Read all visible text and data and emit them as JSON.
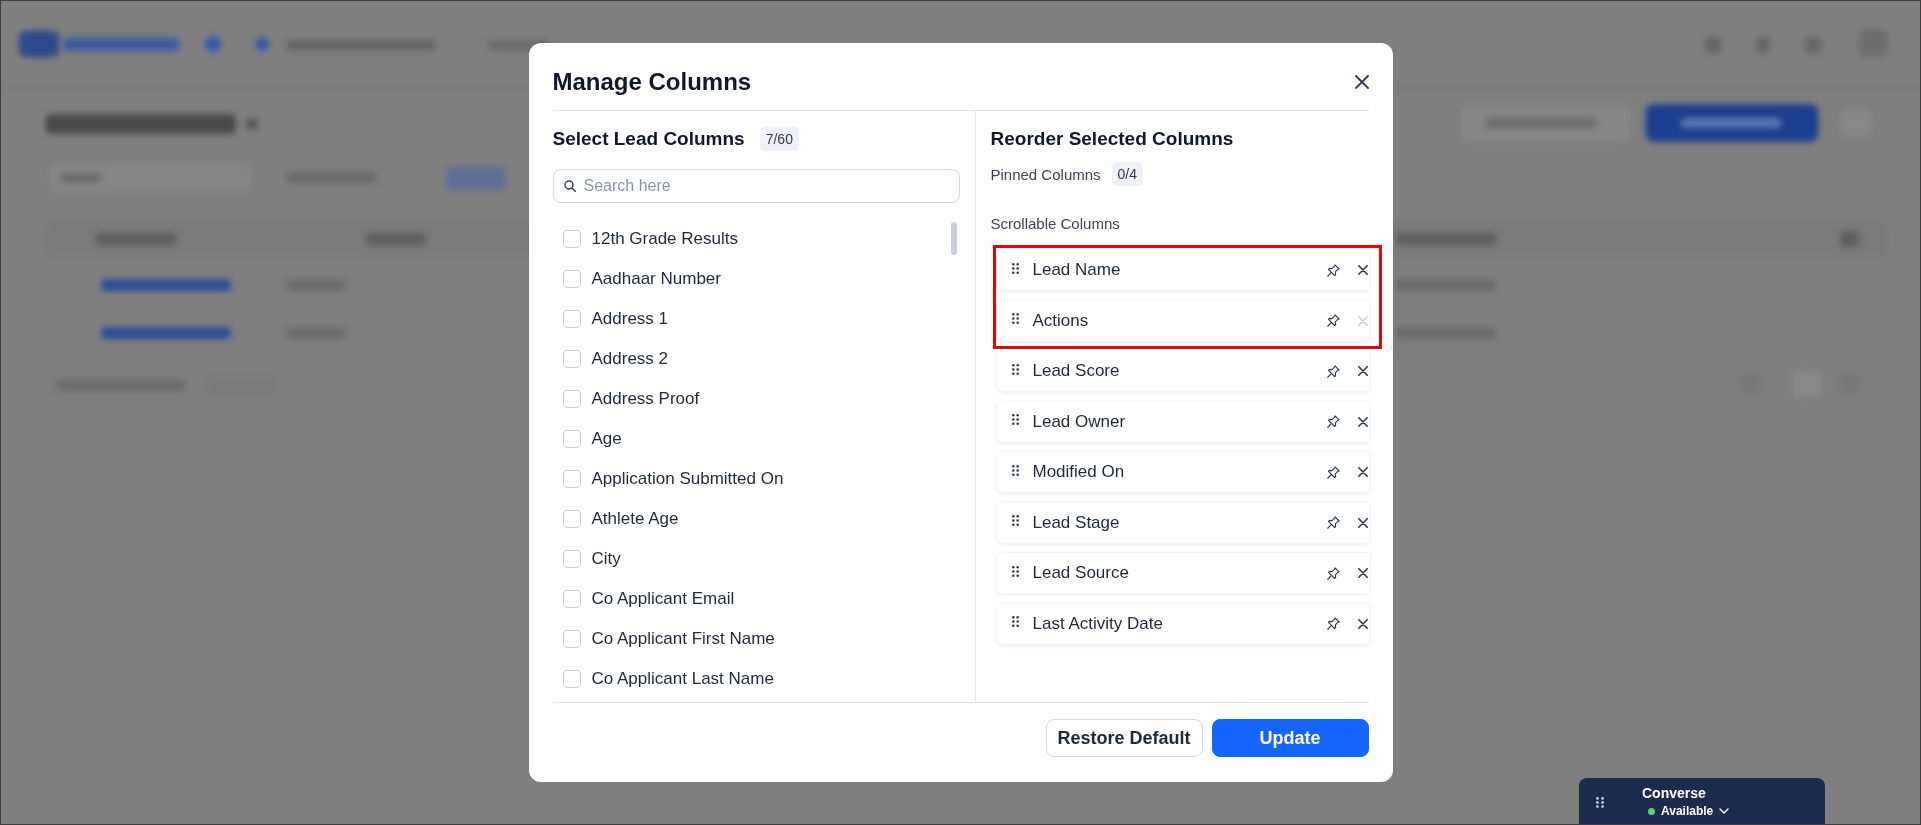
{
  "dialog": {
    "title": "Manage Columns"
  },
  "available_columns": {
    "title": "Select Lead Columns",
    "count": "7/60",
    "search": {
      "placeholder": "Search here"
    },
    "items": [
      {
        "label": "12th Grade Results",
        "checked": false
      },
      {
        "label": "Aadhaar Number",
        "checked": false
      },
      {
        "label": "Address 1",
        "checked": false
      },
      {
        "label": "Address 2",
        "checked": false
      },
      {
        "label": "Address Proof",
        "checked": false
      },
      {
        "label": "Age",
        "checked": false
      },
      {
        "label": "Application Submitted On",
        "checked": false
      },
      {
        "label": "Athlete Age",
        "checked": false
      },
      {
        "label": "City",
        "checked": false
      },
      {
        "label": "Co Applicant Email",
        "checked": false
      },
      {
        "label": "Co Applicant First Name",
        "checked": false
      },
      {
        "label": "Co Applicant Last Name",
        "checked": false
      }
    ]
  },
  "selected_columns": {
    "title": "Reorder Selected Columns",
    "pinned": {
      "label": "Pinned Columns",
      "count": "0/4"
    },
    "scrollable": {
      "label": "Scrollable Columns",
      "items": [
        {
          "label": "Lead Name",
          "removable": true,
          "highlighted": true
        },
        {
          "label": "Actions",
          "removable": false,
          "highlighted": true
        },
        {
          "label": "Lead Score",
          "removable": true,
          "highlighted": false
        },
        {
          "label": "Lead Owner",
          "removable": true,
          "highlighted": false
        },
        {
          "label": "Modified On",
          "removable": true,
          "highlighted": false
        },
        {
          "label": "Lead Stage",
          "removable": true,
          "highlighted": false
        },
        {
          "label": "Lead Source",
          "removable": true,
          "highlighted": false
        },
        {
          "label": "Last Activity Date",
          "removable": true,
          "highlighted": false
        }
      ]
    }
  },
  "buttons": [
    {
      "label": "Restore Default",
      "kind": "secondary"
    },
    {
      "label": "Update",
      "kind": "primary"
    }
  ],
  "converse_widget": {
    "title": "Converse",
    "status": {
      "label": "Available",
      "color": "#5fd068"
    }
  }
}
